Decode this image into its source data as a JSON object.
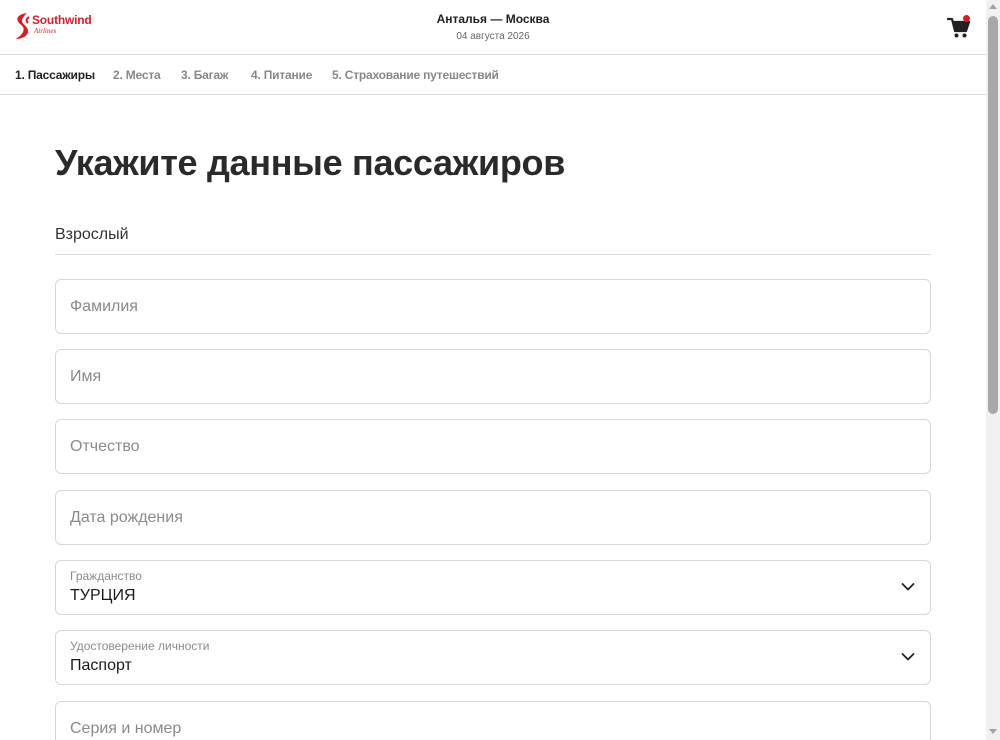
{
  "brand": {
    "name": "Southwind",
    "sub": "Airlines",
    "color": "#d21f2b",
    "icon": "southwind-s-logo"
  },
  "header": {
    "route": "Анталья — Москва",
    "date": "04 августа 2026",
    "cart_icon": "shopping-cart-icon",
    "cart_badge_color": "#d21f2b"
  },
  "steps": [
    {
      "label": "1. Пассажиры",
      "active": true
    },
    {
      "label": "2. Места",
      "active": false
    },
    {
      "label": "3. Багаж",
      "active": false
    },
    {
      "label": "4. Питание",
      "active": false
    },
    {
      "label": "5. Страхование путешествий",
      "active": false
    }
  ],
  "main": {
    "title": "Укажите данные пассажиров",
    "passenger_type": "Взрослый",
    "fields": {
      "last_name": {
        "placeholder": "Фамилия",
        "value": ""
      },
      "first_name": {
        "placeholder": "Имя",
        "value": ""
      },
      "middle_name": {
        "placeholder": "Отчество",
        "value": ""
      },
      "birth_date": {
        "placeholder": "Дата рождения",
        "value": ""
      },
      "citizenship": {
        "label": "Гражданство",
        "value": "ТУРЦИЯ"
      },
      "id_document": {
        "label": "Удостоверение личности",
        "value": "Паспорт"
      },
      "doc_number": {
        "placeholder": "Серия и номер",
        "value": ""
      }
    }
  }
}
